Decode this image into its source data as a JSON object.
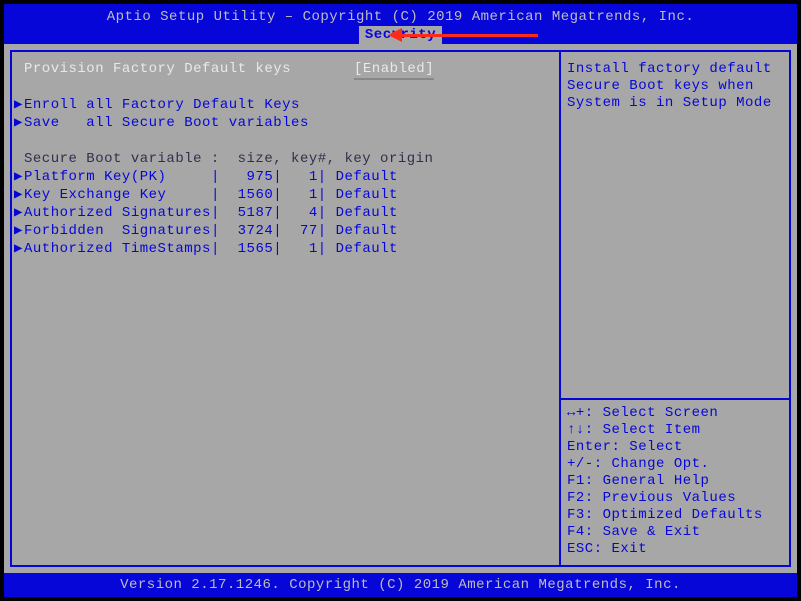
{
  "header": {
    "title": "Aptio Setup Utility – Copyright (C) 2019 American Megatrends, Inc.",
    "tab": "Security"
  },
  "main": {
    "selected": {
      "label": "Provision Factory Default keys",
      "value": "[Enabled]"
    },
    "links": {
      "enroll": "Enroll all Factory Default Keys",
      "save": "Save   all Secure Boot variables"
    },
    "table_header": "Secure Boot variable :  size, key#, key origin",
    "rows": [
      {
        "name": "Platform Key(PK)     ",
        "size": "  975",
        "keys": "  1",
        "origin": "Default"
      },
      {
        "name": "Key Exchange Key     ",
        "size": " 1560",
        "keys": "  1",
        "origin": "Default"
      },
      {
        "name": "Authorized Signatures",
        "size": " 5187",
        "keys": "  4",
        "origin": "Default"
      },
      {
        "name": "Forbidden  Signatures",
        "size": " 3724",
        "keys": " 77",
        "origin": "Default"
      },
      {
        "name": "Authorized TimeStamps",
        "size": " 1565",
        "keys": "  1",
        "origin": "Default"
      }
    ]
  },
  "side": {
    "help": [
      "Install factory default",
      "Secure Boot keys when",
      "System is in Setup Mode"
    ],
    "hints": [
      "↔+: Select Screen",
      "↑↓: Select Item",
      "Enter: Select",
      "+/-: Change Opt.",
      "F1: General Help",
      "F2: Previous Values",
      "F3: Optimized Defaults",
      "F4: Save & Exit",
      "ESC: Exit"
    ]
  },
  "footer": {
    "text": "Version 2.17.1246. Copyright (C) 2019 American Megatrends, Inc."
  }
}
